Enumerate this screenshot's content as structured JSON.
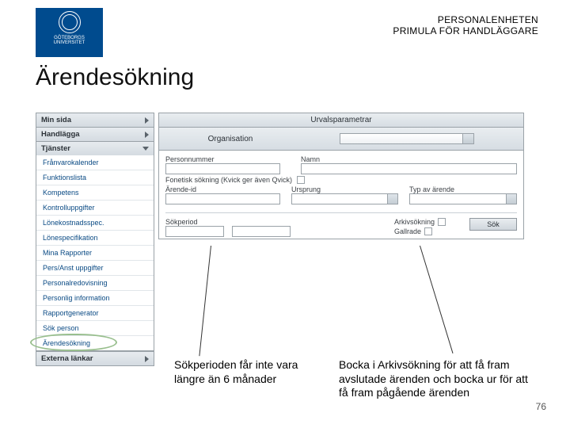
{
  "header": {
    "dept": "PERSONALENHETEN",
    "system": "PRIMULA FÖR HANDLÄGGARE",
    "logo_top": "GÖTEBORGS",
    "logo_bottom": "UNIVERSITET"
  },
  "title": "Ärendesökning",
  "panel": {
    "title": "Urvalsparametrar",
    "org_label": "Organisation",
    "personnummer_label": "Personnummer",
    "namn_label": "Namn",
    "fonetisk_label": "Fonetisk sökning (Kvick ger även Qvick)",
    "arende_id_label": "Ärende-id",
    "ursprung_label": "Ursprung",
    "typ_label": "Typ av ärende",
    "sokperiod_label": "Sökperiod",
    "arkiv_label": "Arkivsökning",
    "gallrade_label": "Gallrade",
    "sok_button": "Sök"
  },
  "sidebar": {
    "min_sida": "Min sida",
    "handlagga": "Handlägga",
    "tjanster": "Tjänster",
    "items": [
      "Frånvarokalender",
      "Funktionslista",
      "Kompetens",
      "Kontrolluppgifter",
      "Lönekostnadsspec.",
      "Lönespecifikation",
      "Mina Rapporter",
      "Pers/Anst uppgifter",
      "Personalredovisning",
      "Personlig information",
      "Rapportgenerator",
      "Sök person",
      "Ärendesökning"
    ],
    "externa": "Externa länkar"
  },
  "callouts": {
    "c1": "Sökperioden får inte vara längre än 6 månader",
    "c2": "Bocka i Arkivsökning för att få fram avslutade ärenden och bocka ur för att få fram pågående ärenden"
  },
  "page_number": "76"
}
